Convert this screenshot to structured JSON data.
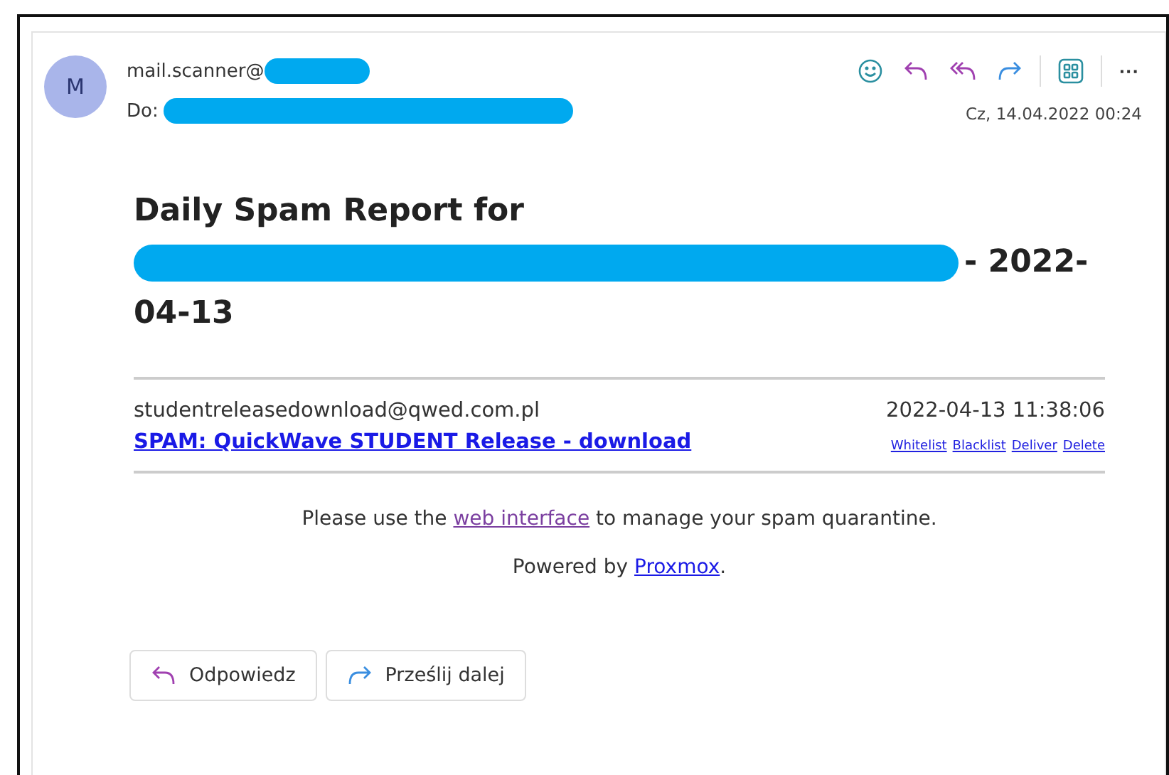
{
  "header": {
    "avatar": "M",
    "sender": "mail.scanner@",
    "to_label": "Do:",
    "date": "Cz, 14.04.2022 00:24",
    "more": "···"
  },
  "title": {
    "start": "Daily Spam Report for",
    "end": "- 2022-",
    "last": "04-13"
  },
  "entries": [
    {
      "from": "studentreleasedownload@qwed.com.pl",
      "time": "2022-04-13 11:38:06",
      "subject": "SPAM: QuickWave STUDENT Release - download",
      "actions": [
        "Whitelist",
        "Blacklist",
        "Deliver",
        "Delete"
      ]
    }
  ],
  "footer": {
    "before": "Please use the",
    "link": "web interface",
    "after": "to manage your spam quarantine.",
    "powered": "Powered by",
    "powered_link": "Proxmox",
    "dot": "."
  },
  "buttons": [
    {
      "kind": "reply",
      "label": "Odpowiedz"
    },
    {
      "kind": "forward",
      "label": "Prześlij dalej"
    }
  ]
}
